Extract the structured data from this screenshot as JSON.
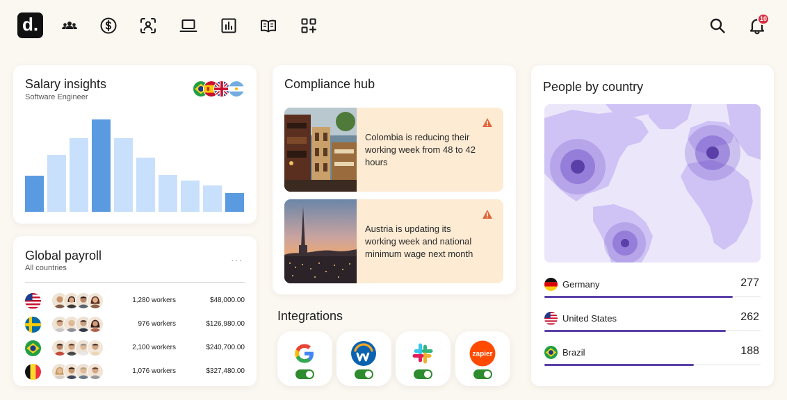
{
  "nav": {
    "logo_text": "d.",
    "icons": [
      "people-icon",
      "dollar-icon",
      "person-scan-icon",
      "laptop-icon",
      "chart-icon",
      "book-icon",
      "apps-add-icon"
    ],
    "notification_count": "10"
  },
  "salary": {
    "title": "Salary insights",
    "subtitle": "Software Engineer",
    "flags": [
      "brazil",
      "spain",
      "uk",
      "argentina"
    ],
    "bars": [
      {
        "value": 0.38,
        "highlight": true
      },
      {
        "value": 0.6,
        "highlight": false
      },
      {
        "value": 0.78,
        "highlight": false
      },
      {
        "value": 0.98,
        "highlight": true
      },
      {
        "value": 0.78,
        "highlight": false
      },
      {
        "value": 0.57,
        "highlight": false
      },
      {
        "value": 0.39,
        "highlight": false
      },
      {
        "value": 0.33,
        "highlight": false
      },
      {
        "value": 0.28,
        "highlight": false
      },
      {
        "value": 0.2,
        "highlight": true
      }
    ],
    "colors": {
      "highlight": "#5a9ae0",
      "normal": "#c8e0fb"
    }
  },
  "payroll": {
    "title": "Global payroll",
    "subtitle": "All countries",
    "more": "···",
    "rows": [
      {
        "flag": "us",
        "workers": "1,280 workers",
        "amount": "$48,000.00"
      },
      {
        "flag": "sweden",
        "workers": "976 workers",
        "amount": "$126,980.00"
      },
      {
        "flag": "brazil",
        "workers": "2,100 workers",
        "amount": "$240,700.00"
      },
      {
        "flag": "belgium",
        "workers": "1,076 workers",
        "amount": "$327,480.00"
      }
    ]
  },
  "compliance": {
    "title": "Compliance hub",
    "items": [
      {
        "text": "Colombia is reducing their working week from 48 to 42 hours"
      },
      {
        "text": "Austria is updating its working week and national minimum wage next month"
      }
    ]
  },
  "integrations": {
    "title": "Integrations",
    "apps": [
      {
        "name": "google",
        "enabled": true
      },
      {
        "name": "workday",
        "enabled": true
      },
      {
        "name": "slack",
        "enabled": true
      },
      {
        "name": "zapier",
        "label": "zapier",
        "enabled": true
      }
    ]
  },
  "people": {
    "title": "People by country",
    "countries": [
      {
        "flag": "germany",
        "name": "Germany",
        "count": "277",
        "share": 0.87
      },
      {
        "flag": "us",
        "name": "United States",
        "count": "262",
        "share": 0.84
      },
      {
        "flag": "brazil",
        "name": "Brazil",
        "count": "188",
        "share": 0.69
      }
    ],
    "colors": {
      "bar": "#5b3fa8",
      "map_bg": "#ece6fb",
      "land": "#cfc2f5",
      "marker": "#6b4fc8"
    }
  }
}
